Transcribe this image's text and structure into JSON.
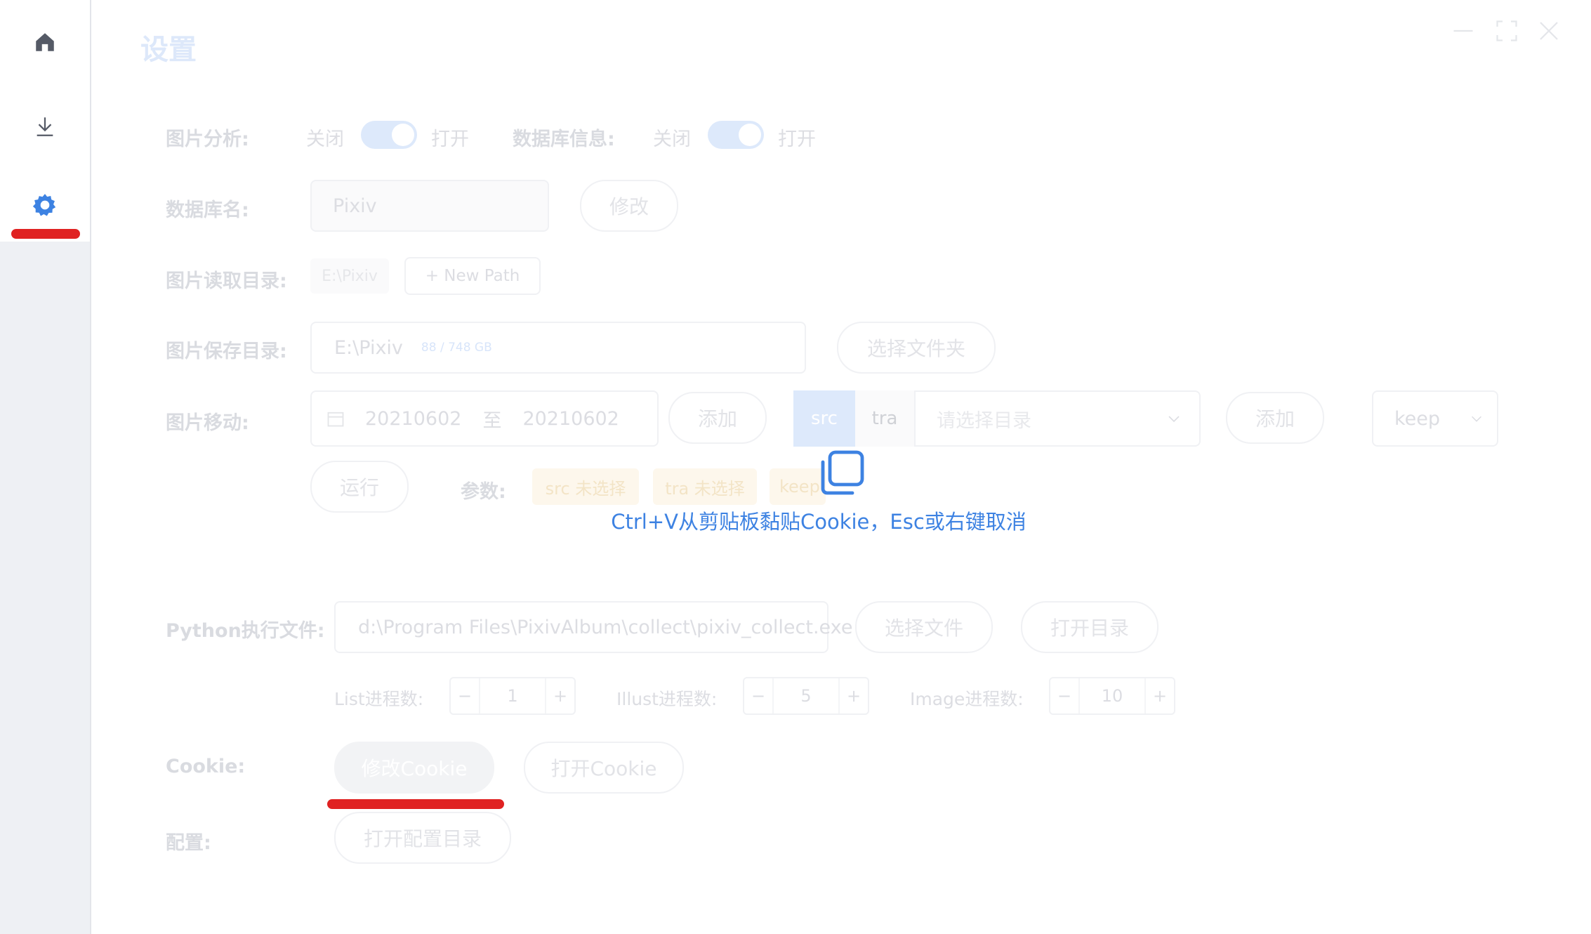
{
  "page": {
    "title": "设置"
  },
  "sidebar": {
    "items": [
      {
        "icon": "home-icon"
      },
      {
        "icon": "download-icon"
      },
      {
        "icon": "gear-icon",
        "active": true
      }
    ],
    "accent": "#3d82e2"
  },
  "settings": {
    "image_analysis": {
      "label": "图片分析:",
      "off": "关闭",
      "on": "打开"
    },
    "db_info": {
      "label": "数据库信息:",
      "off": "关闭",
      "on": "打开"
    },
    "db_name": {
      "label": "数据库名:",
      "value": "Pixiv",
      "button": "修改"
    },
    "read_dir": {
      "label": "图片读取目录:",
      "tag": "E:\\Pixiv",
      "button": "+ New Path"
    },
    "save_dir": {
      "label": "图片保存目录:",
      "value": "E:\\Pixiv",
      "disk": "88 / 748 GB",
      "button": "选择文件夹"
    },
    "move": {
      "label": "图片移动:",
      "date_from": "20210602",
      "date_sep": "至",
      "date_to": "20210602",
      "add1": "添加",
      "seg_src": "src",
      "seg_tra": "tra",
      "select_placeholder": "请选择目录",
      "add2": "添加",
      "mode": "keep",
      "run": "运行",
      "params_label": "参数:",
      "param_src": "src 未选择",
      "param_tra": "tra 未选择",
      "param_keep": "keep"
    },
    "python": {
      "label": "Python执行文件:",
      "value": "d:\\Program Files\\PixivAlbum\\collect\\pixiv_collect.exe",
      "select_file": "选择文件",
      "open_dir": "打开目录"
    },
    "threads": {
      "list_label": "List进程数:",
      "list_value": "1",
      "illust_label": "Illust进程数:",
      "illust_value": "5",
      "image_label": "Image进程数:",
      "image_value": "10",
      "minus": "−",
      "plus": "+"
    },
    "cookie": {
      "label": "Cookie:",
      "edit": "修改Cookie",
      "open": "打开Cookie"
    },
    "config": {
      "label": "配置:",
      "open": "打开配置目录"
    }
  },
  "overlay": {
    "message": "Ctrl+V从剪贴板黏贴Cookie，Esc或右键取消",
    "icon": "copy-icon",
    "color": "#3d82e2"
  },
  "window_controls": {
    "minimize": "minimize-icon",
    "maximize": "maximize-icon",
    "close": "close-icon"
  }
}
